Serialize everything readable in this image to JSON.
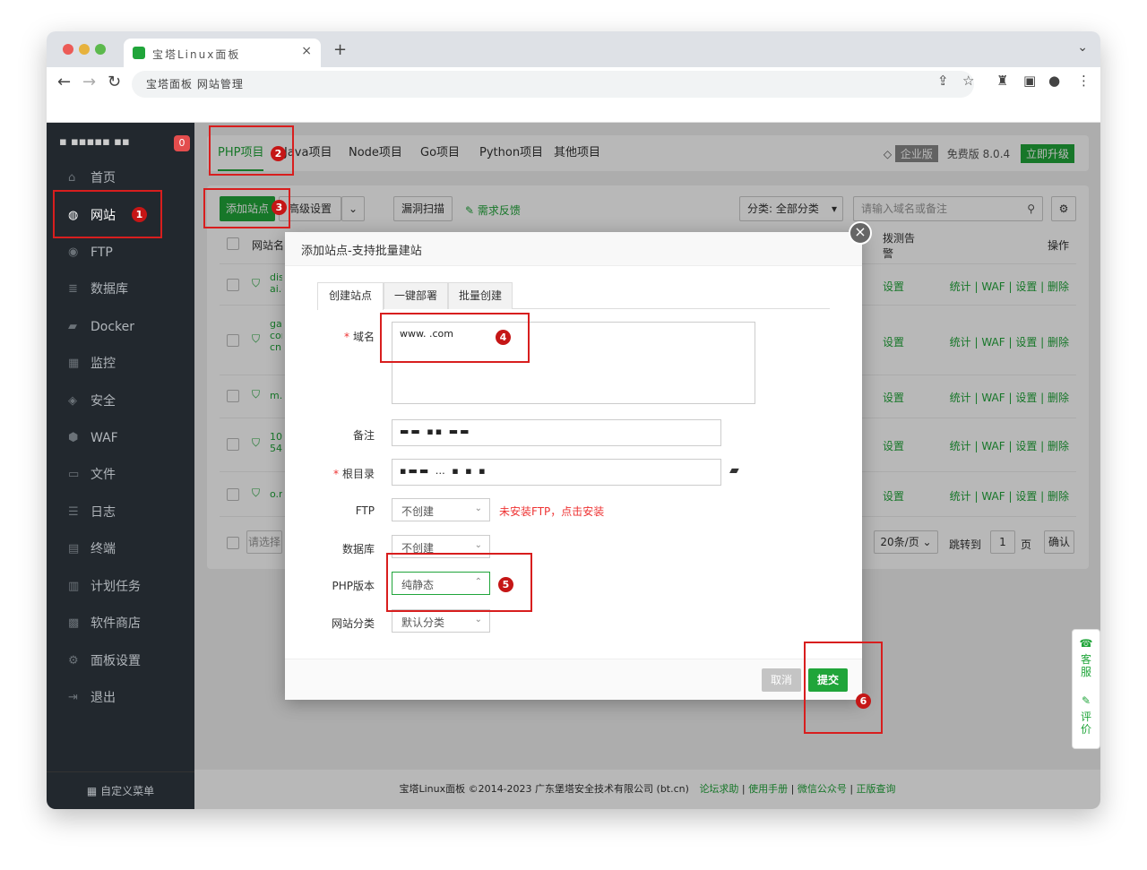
{
  "browser": {
    "tab_title": "宝塔Linux面板",
    "new_tab": "+",
    "url": "宝塔面板 网站管理"
  },
  "sidebar": {
    "logo_badge": "0",
    "items": [
      {
        "label": "首页",
        "icon": "home-icon"
      },
      {
        "label": "网站",
        "icon": "globe-icon"
      },
      {
        "label": "FTP",
        "icon": "ftp-icon"
      },
      {
        "label": "数据库",
        "icon": "database-icon"
      },
      {
        "label": "Docker",
        "icon": "docker-icon"
      },
      {
        "label": "监控",
        "icon": "monitor-icon"
      },
      {
        "label": "安全",
        "icon": "shield-icon"
      },
      {
        "label": "WAF",
        "icon": "waf-icon"
      },
      {
        "label": "文件",
        "icon": "folder-icon"
      },
      {
        "label": "日志",
        "icon": "log-icon"
      },
      {
        "label": "终端",
        "icon": "terminal-icon"
      },
      {
        "label": "计划任务",
        "icon": "calendar-icon"
      },
      {
        "label": "软件商店",
        "icon": "grid-icon"
      },
      {
        "label": "面板设置",
        "icon": "gear-icon"
      },
      {
        "label": "退出",
        "icon": "logout-icon"
      }
    ],
    "footer": "自定义菜单"
  },
  "top_tabs": [
    "PHP项目",
    "Java项目",
    "Node项目",
    "Go项目",
    "Python项目",
    "其他项目"
  ],
  "edition": {
    "enterprise": "企业版",
    "free": "免费版",
    "version": "8.0.4",
    "upgrade": "立即升级"
  },
  "toolbar": {
    "add_site": "添加站点",
    "advanced": "高级设置",
    "scan": "漏洞扫描",
    "feedback": "需求反馈",
    "category": "分类: 全部分类",
    "search_placeholder": "请输入域名或备注"
  },
  "table": {
    "col_name": "网站名",
    "col_alert": "拨测告警",
    "col_ops": "操作",
    "row_prefixes": [
      "dis ai.c",
      "gat cor cn",
      "m.r",
      "10 54",
      "o.m"
    ],
    "set_label": "设置",
    "ops": "统计 | WAF | 设置 | 删除",
    "select_all": "请选择",
    "per_page": "20条/页",
    "jump": "跳转到",
    "page_num": "1",
    "page": "页",
    "confirm": "确认"
  },
  "modal": {
    "title": "添加站点-支持批量建站",
    "tabs": [
      "创建站点",
      "一键部署",
      "批量创建"
    ],
    "domain_label": "域名",
    "domain_value": "www.  .com",
    "remark_label": "备注",
    "root_label": "根目录",
    "ftp_label": "FTP",
    "ftp_value": "不创建",
    "ftp_warn": "未安装FTP，点击安装",
    "db_label": "数据库",
    "db_value": "不创建",
    "php_label": "PHP版本",
    "php_value": "纯静态",
    "cat_label": "网站分类",
    "cat_value": "默认分类",
    "cancel": "取消",
    "submit": "提交"
  },
  "steps": [
    "1",
    "2",
    "3",
    "4",
    "5",
    "6"
  ],
  "support": {
    "service": "客服",
    "rate": "评价"
  },
  "footer": {
    "copyright": "宝塔Linux面板 ©2014-2023 广东堡塔安全技术有限公司 (bt.cn)",
    "links": [
      "论坛求助",
      "使用手册",
      "微信公众号",
      "正版查询"
    ]
  },
  "colors": {
    "brand_green": "#20a53a",
    "annotation_red": "#d81e1e",
    "sidebar_bg": "#22282e"
  }
}
